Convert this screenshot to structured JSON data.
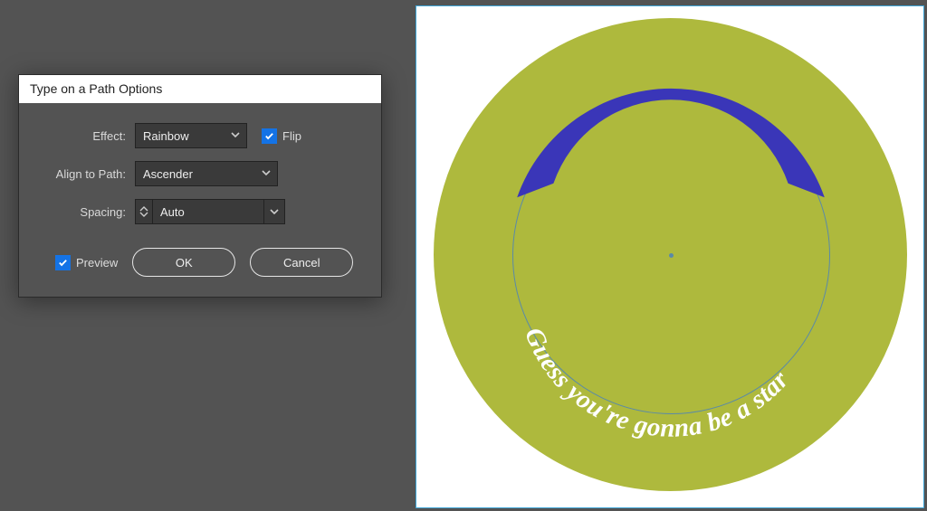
{
  "dialog": {
    "title": "Type on a Path Options",
    "effect_label": "Effect:",
    "effect_value": "Rainbow",
    "flip_label": "Flip",
    "flip_checked": true,
    "align_label": "Align to Path:",
    "align_value": "Ascender",
    "spacing_label": "Spacing:",
    "spacing_value": "Auto",
    "preview_label": "Preview",
    "preview_checked": true,
    "ok": "OK",
    "cancel": "Cancel"
  },
  "artwork": {
    "path_text": "Guess you're gonna be a star",
    "big_fill": "#aeb93d",
    "band_fill": "#3a36b8",
    "text_fill": "#ffffff"
  }
}
